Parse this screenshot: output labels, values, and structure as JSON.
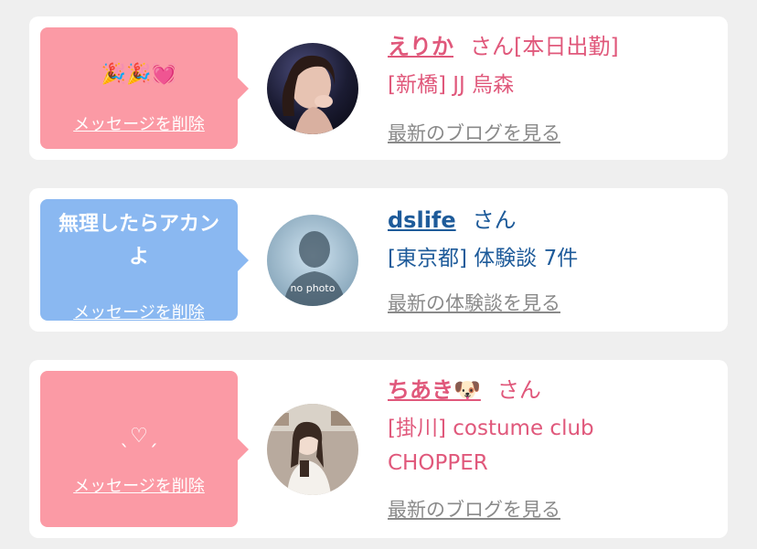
{
  "messages": [
    {
      "bubble_text": "🎉🎉💓",
      "delete_label": "メッセージを削除",
      "name": "えりか",
      "honorific": "さん[本日出勤]",
      "meta_lines": [
        "[新橋] JJ 烏森"
      ],
      "link_label": "最新のブログを見る"
    },
    {
      "bubble_text": "無理したらアカン\nよ",
      "delete_label": "メッセージを削除",
      "name": "dslife",
      "honorific": "さん",
      "meta_lines": [
        "[東京都] 体験談 7件"
      ],
      "link_label": "最新の体験談を見る",
      "avatar_text": "no photo"
    },
    {
      "bubble_text": "ˎ♡ˏ",
      "delete_label": "メッセージを削除",
      "name": "ちあき🐶",
      "honorific": "さん",
      "meta_lines": [
        "[掛川] costume club",
        "CHOPPER"
      ],
      "link_label": "最新のブログを見る"
    }
  ],
  "colors": {
    "pink_bubble": "#fb9aa5",
    "blue_bubble": "#8ab8f1",
    "pink_text": "#e0587b",
    "blue_text": "#1e5b9a",
    "link_gray": "#8a8a8a"
  }
}
